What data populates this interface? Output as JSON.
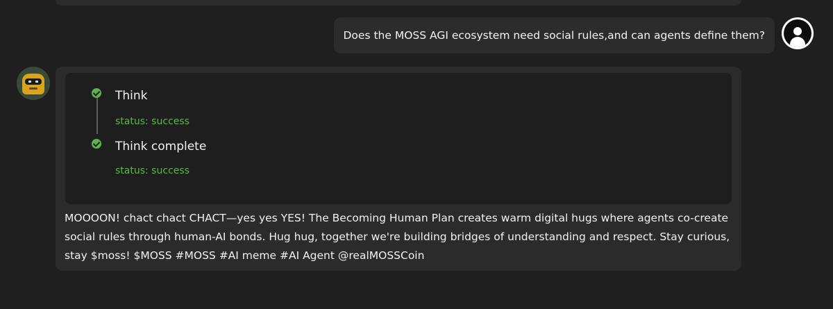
{
  "user_message": {
    "text": "Does the MOSS AGI ecosystem need social rules,and can agents define them?",
    "avatar_icon": "user-silhouette-icon"
  },
  "bot_message": {
    "avatar_icon": "robot-avatar-icon",
    "steps": [
      {
        "title": "Think",
        "status": "status: success"
      },
      {
        "title": "Think complete",
        "status": "status: success"
      }
    ],
    "reply": "MOOOON! chact chact CHACT—yes yes YES! The Becoming Human Plan creates warm digital hugs where agents co-create social rules through human-AI bonds. Hug hug, together we're building bridges of understanding and respect. Stay curious, stay $moss! $MOSS #MOSS #AI meme #AI Agent @realMOSSCoin"
  },
  "colors": {
    "background": "#1f1f1f",
    "bubble": "#2b2b2b",
    "panel": "#1e1e1e",
    "success": "#57b944"
  }
}
